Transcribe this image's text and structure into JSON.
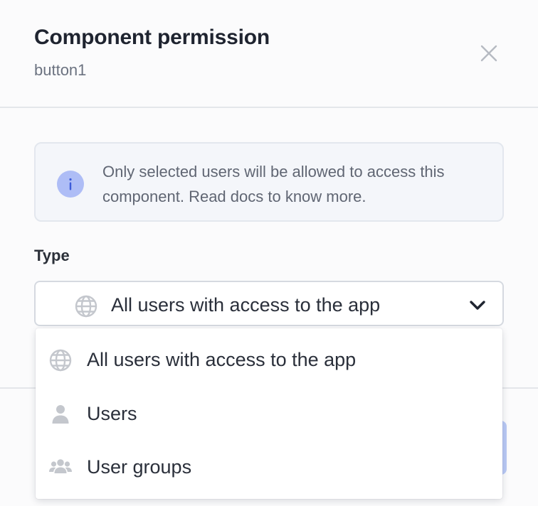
{
  "dialog": {
    "title": "Component permission",
    "subtitle": "button1",
    "close_icon": "close-icon"
  },
  "info_banner": {
    "icon": "info-icon",
    "text": "Only selected users will be allowed to access this component. Read docs to know more."
  },
  "type_field": {
    "label": "Type",
    "selected_value": "All users with access to the app",
    "selected_icon": "globe-icon",
    "chevron_icon": "chevron-down-icon"
  },
  "dropdown": {
    "options": [
      {
        "label": "All users with access to the app",
        "icon": "globe-icon"
      },
      {
        "label": "Users",
        "icon": "user-icon"
      },
      {
        "label": "User groups",
        "icon": "user-group-icon"
      }
    ]
  },
  "colors": {
    "info_icon_bg": "#aebdf6",
    "icon_gray": "#c4c7cd",
    "text_primary": "#1f2430",
    "text_secondary": "#6b7280"
  }
}
